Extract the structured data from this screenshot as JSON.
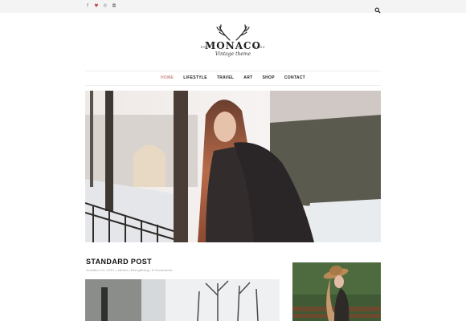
{
  "topbar": {
    "social": [
      {
        "icon": "facebook-icon",
        "glyph": "f",
        "color": "#888888"
      },
      {
        "icon": "twitter-icon",
        "glyph": "♥",
        "color": "#c0504d"
      },
      {
        "icon": "pinterest-icon",
        "glyph": "℗",
        "color": "#888888"
      },
      {
        "icon": "instagram-icon",
        "glyph": "◘",
        "color": "#888888"
      }
    ],
    "search_icon": "search-icon"
  },
  "logo": {
    "est": "EST.",
    "brand": "MONACO",
    "year": "MMXV",
    "tagline": "Vintage theme"
  },
  "nav": {
    "items": [
      {
        "label": "HOME",
        "active": true
      },
      {
        "label": "LIFESTYLE",
        "active": false
      },
      {
        "label": "TRAVEL",
        "active": false
      },
      {
        "label": "ART",
        "active": false
      },
      {
        "label": "SHOP",
        "active": false
      },
      {
        "label": "CONTACT",
        "active": false
      }
    ],
    "active_color": "#c98a8a"
  },
  "post": {
    "title": "STANDARD POST",
    "meta": "October 29, 2015 / admin / Everything / 8 Comments"
  }
}
